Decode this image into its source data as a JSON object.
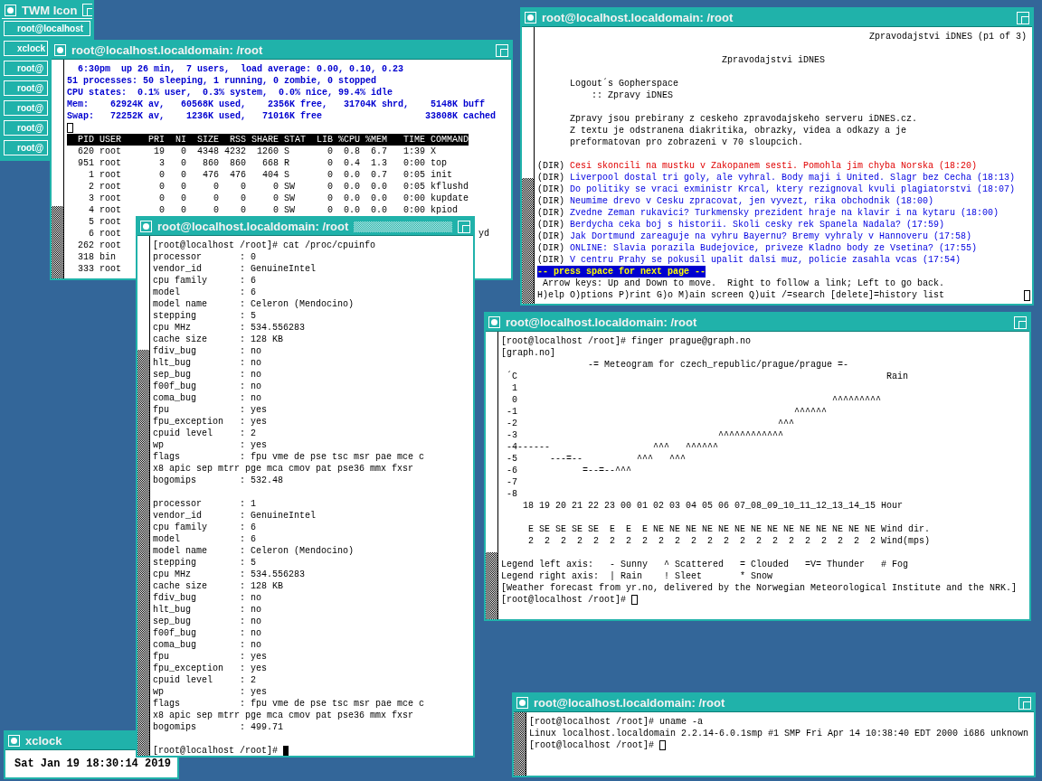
{
  "desktop": {
    "windows": [
      {
        "kind": "icon_manager",
        "title": "TWM Icon",
        "entries": [
          "root@localhost",
          "xclock",
          "root@",
          "root@",
          "root@",
          "root@",
          "root@"
        ]
      },
      {
        "kind": "terminal",
        "title": "root@localhost.localdomain: /root",
        "focused": false,
        "lines": [
          {
            "kind": "header",
            "text": "  6:30pm  up 26 min,  7 users,  load average: 0.00, 0.10, 0.23"
          },
          {
            "kind": "header",
            "text": "51 processes: 50 sleeping, 1 running, 0 zombie, 0 stopped"
          },
          {
            "kind": "header",
            "text": "CPU states:  0.1% user,  0.3% system,  0.0% nice, 99.4% idle"
          },
          {
            "kind": "header",
            "text": "Mem:    62924K av,   60568K used,    2356K free,   31704K shrd,    5148K buff"
          },
          {
            "kind": "header",
            "text": "Swap:   72252K av,    1236K used,   71016K free                   33808K cached"
          },
          {
            "kind": "blank",
            "cursor": {
              "kind": "outline"
            }
          },
          {
            "kind": "inverse",
            "text": "  PID USER     PRI  NI  SIZE  RSS SHARE STAT  LIB %CPU %MEM   TIME COMMAND"
          },
          {
            "kind": "text",
            "text": "  620 root      19   0  4348 4232  1260 S       0  0.8  6.7   1:39 X"
          },
          {
            "kind": "text",
            "text": "  951 root       3   0   860  860   668 R       0  0.4  1.3   0:00 top"
          },
          {
            "kind": "text",
            "text": "    1 root       0   0   476  476   404 S       0  0.0  0.7   0:05 init"
          },
          {
            "kind": "text",
            "text": "    2 root       0   0     0    0     0 SW      0  0.0  0.0   0:05 kflushd"
          },
          {
            "kind": "text",
            "text": "    3 root       0   0     0    0     0 SW      0  0.0  0.0   0:00 kupdate"
          },
          {
            "kind": "text",
            "text": "    4 root       0   0     0    0     0 SW      0  0.0  0.0   0:00 kpiod"
          },
          {
            "kind": "text",
            "text": "    5 root"
          },
          {
            "kind": "text",
            "text": "    6 root",
            "tail": "yd"
          },
          {
            "kind": "text",
            "text": "  262 root"
          },
          {
            "kind": "text",
            "text": "  318 bin"
          },
          {
            "kind": "text",
            "text": "  333 root"
          }
        ]
      },
      {
        "kind": "terminal",
        "title": "root@localhost.localdomain: /root",
        "focused": false,
        "lines": [
          {
            "kind": "right",
            "text": "Zpravodajstvi iDNES (p1 of 3)"
          },
          {
            "kind": "blank"
          },
          {
            "kind": "text",
            "text": "                                  Zpravodajstvi iDNES"
          },
          {
            "kind": "blank"
          },
          {
            "kind": "text",
            "text": "      Logout´s Gopherspace"
          },
          {
            "kind": "text",
            "text": "          :: Zpravy iDNES"
          },
          {
            "kind": "blank"
          },
          {
            "kind": "text",
            "text": "      Zpravy jsou prebirany z ceskeho zpravodajskeho serveru iDNES.cz."
          },
          {
            "kind": "text",
            "text": "      Z textu je odstranena diakritika, obrazky, videa a odkazy a je"
          },
          {
            "kind": "text",
            "text": "      preformatovan pro zobrazeni v 70 sloupcich."
          },
          {
            "kind": "blank"
          },
          {
            "kind": "dir",
            "prefix": "(DIR)",
            "text": "Cesi skoncili na mustku v Zakopanem sesti. Pomohla jim chyba Norska (18:20)",
            "selected": true
          },
          {
            "kind": "dir",
            "prefix": "(DIR)",
            "text": "Liverpool dostal tri goly, ale vyhral. Body maji i United. Slagr bez Cecha (18:13)",
            "selected": false
          },
          {
            "kind": "dir",
            "prefix": "(DIR)",
            "text": "Do politiky se vraci exministr Krcal, ktery rezignoval kvuli plagiatorstvi (18:07)",
            "selected": false
          },
          {
            "kind": "dir",
            "prefix": "(DIR)",
            "text": "Neumime drevo v Cesku zpracovat, jen vyvezt, rika obchodnik (18:00)",
            "selected": false
          },
          {
            "kind": "dir",
            "prefix": "(DIR)",
            "text": "Zvedne Zeman rukavici? Turkmensky prezident hraje na klavir i na kytaru (18:00)",
            "selected": false
          },
          {
            "kind": "dir",
            "prefix": "(DIR)",
            "text": "Berdycha ceka boj s historii. Skoli cesky rek Spanela Nadala? (17:59)",
            "selected": false
          },
          {
            "kind": "dir",
            "prefix": "(DIR)",
            "text": "Jak Dortmund zareaguje na vyhru Bayernu? Bremy vyhraly v Hannoveru (17:58)",
            "selected": false
          },
          {
            "kind": "dir",
            "prefix": "(DIR)",
            "text": "ONLINE: Slavia porazila Budejovice, priveze Kladno body ze Vsetina? (17:55)",
            "selected": false
          },
          {
            "kind": "dir",
            "prefix": "(DIR)",
            "text": "V centru Prahy se pokusil upalit dalsi muz, policie zasahla vcas (17:54)",
            "selected": false
          },
          {
            "kind": "prompt",
            "text": "-- press space for next page --"
          },
          {
            "kind": "text",
            "text": " Arrow keys: Up and Down to move.  Right to follow a link; Left to go back."
          },
          {
            "kind": "text",
            "text": "H)elp O)ptions P)rint G)o M)ain screen Q)uit /=search [delete]=history list",
            "cursor": {
              "kind": "outline_end"
            }
          }
        ]
      },
      {
        "kind": "terminal",
        "title": "root@localhost.localdomain: /root",
        "focused": true,
        "lines": [
          {
            "kind": "text",
            "text": "[root@localhost /root]# cat /proc/cpuinfo"
          },
          {
            "kind": "text",
            "text": "processor       : 0"
          },
          {
            "kind": "text",
            "text": "vendor_id       : GenuineIntel"
          },
          {
            "kind": "text",
            "text": "cpu family      : 6"
          },
          {
            "kind": "text",
            "text": "model           : 6"
          },
          {
            "kind": "text",
            "text": "model name      : Celeron (Mendocino)"
          },
          {
            "kind": "text",
            "text": "stepping        : 5"
          },
          {
            "kind": "text",
            "text": "cpu MHz         : 534.556283"
          },
          {
            "kind": "text",
            "text": "cache size      : 128 KB"
          },
          {
            "kind": "text",
            "text": "fdiv_bug        : no"
          },
          {
            "kind": "text",
            "text": "hlt_bug         : no"
          },
          {
            "kind": "text",
            "text": "sep_bug         : no"
          },
          {
            "kind": "text",
            "text": "f00f_bug        : no"
          },
          {
            "kind": "text",
            "text": "coma_bug        : no"
          },
          {
            "kind": "text",
            "text": "fpu             : yes"
          },
          {
            "kind": "text",
            "text": "fpu_exception   : yes"
          },
          {
            "kind": "text",
            "text": "cpuid level     : 2"
          },
          {
            "kind": "text",
            "text": "wp              : yes"
          },
          {
            "kind": "text",
            "text": "flags           : fpu vme de pse tsc msr pae mce c"
          },
          {
            "kind": "text",
            "text": "x8 apic sep mtrr pge mca cmov pat pse36 mmx fxsr"
          },
          {
            "kind": "text",
            "text": "bogomips        : 532.48"
          },
          {
            "kind": "blank"
          },
          {
            "kind": "text",
            "text": "processor       : 1"
          },
          {
            "kind": "text",
            "text": "vendor_id       : GenuineIntel"
          },
          {
            "kind": "text",
            "text": "cpu family      : 6"
          },
          {
            "kind": "text",
            "text": "model           : 6"
          },
          {
            "kind": "text",
            "text": "model name      : Celeron (Mendocino)"
          },
          {
            "kind": "text",
            "text": "stepping        : 5"
          },
          {
            "kind": "text",
            "text": "cpu MHz         : 534.556283"
          },
          {
            "kind": "text",
            "text": "cache size      : 128 KB"
          },
          {
            "kind": "text",
            "text": "fdiv_bug        : no"
          },
          {
            "kind": "text",
            "text": "hlt_bug         : no"
          },
          {
            "kind": "text",
            "text": "sep_bug         : no"
          },
          {
            "kind": "text",
            "text": "f00f_bug        : no"
          },
          {
            "kind": "text",
            "text": "coma_bug        : no"
          },
          {
            "kind": "text",
            "text": "fpu             : yes"
          },
          {
            "kind": "text",
            "text": "fpu_exception   : yes"
          },
          {
            "kind": "text",
            "text": "cpuid level     : 2"
          },
          {
            "kind": "text",
            "text": "wp              : yes"
          },
          {
            "kind": "text",
            "text": "flags           : fpu vme de pse tsc msr pae mce c"
          },
          {
            "kind": "text",
            "text": "x8 apic sep mtrr pge mca cmov pat pse36 mmx fxsr"
          },
          {
            "kind": "text",
            "text": "bogomips        : 499.71"
          },
          {
            "kind": "blank"
          },
          {
            "kind": "text",
            "text": "[root@localhost /root]# ",
            "cursor": {
              "kind": "block"
            }
          }
        ]
      },
      {
        "kind": "terminal",
        "title": "root@localhost.localdomain: /root",
        "focused": false,
        "lines": [
          {
            "kind": "text",
            "text": "[root@localhost /root]# finger prague@graph.no"
          },
          {
            "kind": "text",
            "text": "[graph.no]"
          },
          {
            "kind": "text",
            "text": "                -= Meteogram for czech_republic/prague/prague =-"
          },
          {
            "kind": "text",
            "text": " ´C                                                                    Rain"
          },
          {
            "kind": "text",
            "text": "  1"
          },
          {
            "kind": "text",
            "text": "  0                                                          ^^^^^^^^^"
          },
          {
            "kind": "text",
            "text": " -1                                                   ^^^^^^"
          },
          {
            "kind": "text",
            "text": " -2                                                ^^^"
          },
          {
            "kind": "text",
            "text": " -3                                     ^^^^^^^^^^^^"
          },
          {
            "kind": "text",
            "text": " -4------                   ^^^   ^^^^^^"
          },
          {
            "kind": "text",
            "text": " -5      ---=--          ^^^   ^^^"
          },
          {
            "kind": "text",
            "text": " -6            =--=--^^^"
          },
          {
            "kind": "text",
            "text": " -7"
          },
          {
            "kind": "text",
            "text": " -8"
          },
          {
            "kind": "text",
            "text": "    18 19 20 21 22 23 00 01 02 03 04 05 06 07_08_09_10_11_12_13_14_15 Hour"
          },
          {
            "kind": "blank"
          },
          {
            "kind": "text",
            "text": "     E SE SE SE SE  E  E  E NE NE NE NE NE NE NE NE NE NE NE NE NE NE Wind dir."
          },
          {
            "kind": "text",
            "text": "     2  2  2  2  2  2  2  2  2  2  2  2  2  2  2  2  2  2  2  2  2  2 Wind(mps)"
          },
          {
            "kind": "blank"
          },
          {
            "kind": "text",
            "text": "Legend left axis:   - Sunny   ^ Scattered   = Clouded   =V= Thunder   # Fog"
          },
          {
            "kind": "text",
            "text": "Legend right axis:  | Rain    ! Sleet       * Snow"
          },
          {
            "kind": "text",
            "text": "[Weather forecast from yr.no, delivered by the Norwegian Meteorological Institute and the NRK.]"
          },
          {
            "kind": "text",
            "text": "[root@localhost /root]# ",
            "cursor": {
              "kind": "outline"
            }
          }
        ]
      },
      {
        "kind": "clock",
        "title": "xclock",
        "time": "Sat Jan 19 18:30:14 2019"
      },
      {
        "kind": "terminal",
        "title": "root@localhost.localdomain: /root",
        "focused": false,
        "lines": [
          {
            "kind": "text",
            "text": "[root@localhost /root]# uname -a"
          },
          {
            "kind": "text",
            "text": "Linux localhost.localdomain 2.2.14-6.0.1smp #1 SMP Fri Apr 14 10:38:40 EDT 2000 i686 unknown"
          },
          {
            "kind": "text",
            "text": "[root@localhost /root]# ",
            "cursor": {
              "kind": "outline"
            }
          }
        ]
      }
    ]
  }
}
